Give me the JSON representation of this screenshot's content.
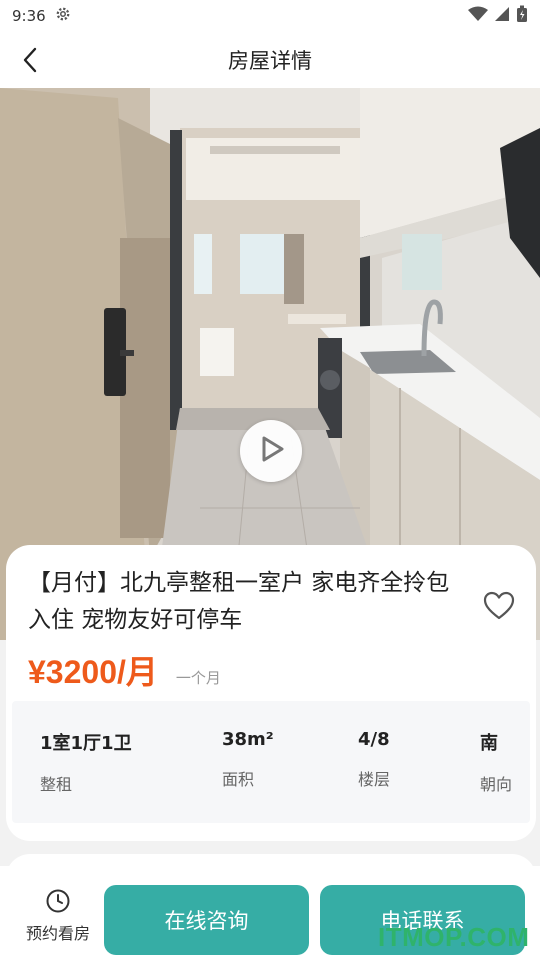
{
  "status_bar": {
    "time": "9:36",
    "icons": [
      "gear-icon",
      "wifi-icon",
      "signal-icon",
      "battery-icon"
    ]
  },
  "header": {
    "title": "房屋详情",
    "back_icon": "back-arrow-icon"
  },
  "hero": {
    "play_icon": "play-icon"
  },
  "listing": {
    "title": "【月付】北九亭整租一室户 家电齐全拎包入住 宠物友好可停车",
    "price": "¥3200/月",
    "term": "一个月",
    "favorite_icon": "heart-outline-icon"
  },
  "specs": [
    {
      "value": "1室1厅1卫",
      "label": "整租"
    },
    {
      "value": "38m²",
      "label": "面积"
    },
    {
      "value": "4/8",
      "label": "楼层"
    },
    {
      "value": "南",
      "label": "朝向"
    }
  ],
  "bottom_bar": {
    "schedule_label": "预约看房",
    "schedule_icon": "clock-icon",
    "consult_label": "在线咨询",
    "call_label": "电话联系"
  },
  "watermark": "ITMOP.COM",
  "colors": {
    "accent": "#36ada5",
    "price": "#ee5a1b"
  }
}
